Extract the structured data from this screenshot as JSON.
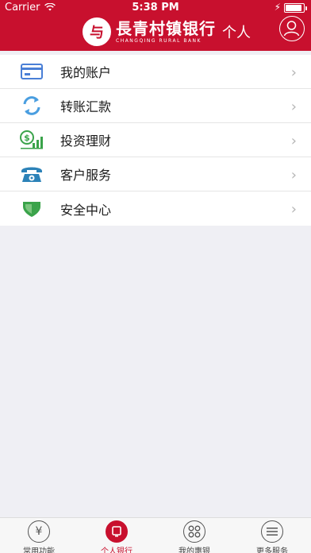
{
  "status_bar": {
    "carrier": "Carrier",
    "time": "5:38 PM",
    "battery_level": 0.9
  },
  "header": {
    "logo_char": "与",
    "bank_name_cn": "長青村镇银行",
    "bank_name_en": "CHANGQING RURAL BANK",
    "section": "个人",
    "brand_color": "#c8102e"
  },
  "menu": {
    "items": [
      {
        "label": "我的账户",
        "icon": "card-icon"
      },
      {
        "label": "转账汇款",
        "icon": "transfer-icon"
      },
      {
        "label": "投资理财",
        "icon": "investment-icon"
      },
      {
        "label": "客户服务",
        "icon": "phone-icon"
      },
      {
        "label": "安全中心",
        "icon": "shield-icon"
      }
    ]
  },
  "tabs": [
    {
      "label": "常用功能",
      "icon": "yen-icon",
      "glyph": "¥",
      "active": false
    },
    {
      "label": "个人银行",
      "icon": "personal-bank-icon",
      "glyph": "▢",
      "active": true
    },
    {
      "label": "我的惠银",
      "icon": "grid-icon",
      "glyph": "",
      "active": false
    },
    {
      "label": "更多服务",
      "icon": "menu-icon",
      "glyph": "",
      "active": false
    }
  ]
}
